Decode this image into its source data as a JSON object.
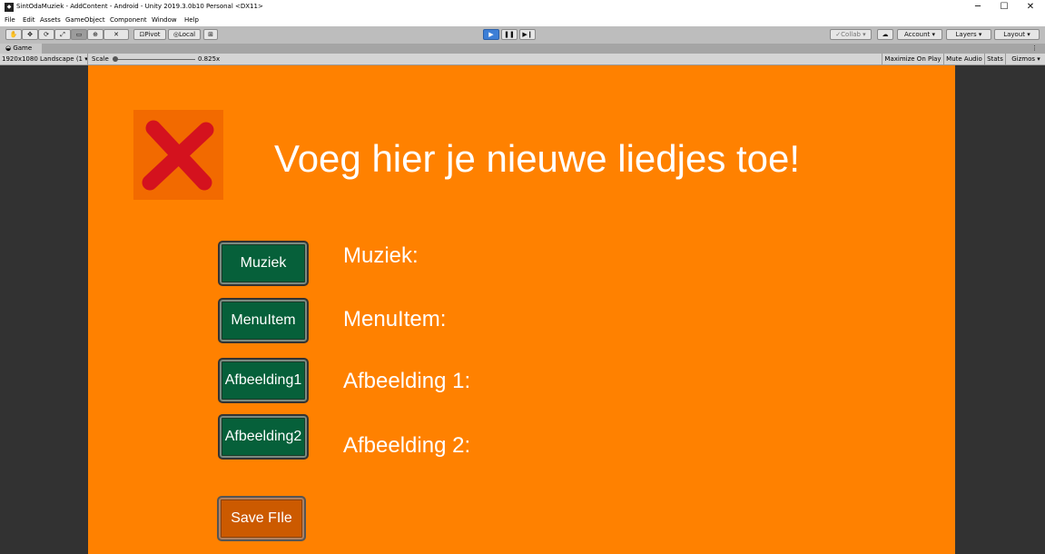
{
  "window": {
    "title": "SintOdaMuziek - AddContent - Android - Unity 2019.3.0b10 Personal <DX11>",
    "icon_name": "unity-icon",
    "controls": [
      "─",
      "☐",
      "✕"
    ]
  },
  "menu": [
    "File",
    "Edit",
    "Assets",
    "GameObject",
    "Component",
    "Window",
    "Help"
  ],
  "toolbar": {
    "tools": [
      "✋",
      "✥",
      "⟳",
      "⤢",
      "▭",
      "⊕",
      "✕"
    ],
    "pivot": "Pivot",
    "local": "Local",
    "collab": "Collab",
    "account": "Account",
    "layers": "Layers",
    "layout": "Layout",
    "play_icon": "▶",
    "pause_icon": "❚❚",
    "step_icon": "▶❙"
  },
  "game_view": {
    "tab": "Game",
    "resolution": "1920x1080 Landscape (1",
    "scale_label": "Scale",
    "scale_value": "0.825x",
    "maximize": "Maximize On Play",
    "mute": "Mute Audio",
    "stats": "Stats",
    "gizmos": "Gizmos"
  },
  "scene": {
    "heading": "Voeg hier je nieuwe liedjes toe!",
    "close_icon_color": "#d4121e",
    "buttons": [
      {
        "label": "Muziek"
      },
      {
        "label": "MenuItem"
      },
      {
        "label": "Afbeelding1"
      },
      {
        "label": "Afbeelding2"
      }
    ],
    "labels": [
      {
        "text": "Muziek:"
      },
      {
        "text": "MenuItem:"
      },
      {
        "text": "Afbeelding 1:"
      },
      {
        "text": "Afbeelding 2:"
      }
    ],
    "save_label": "Save FIle",
    "colors": {
      "background": "#ff8100",
      "button_green": "#06603a",
      "save_button": "#cc5a00"
    }
  }
}
